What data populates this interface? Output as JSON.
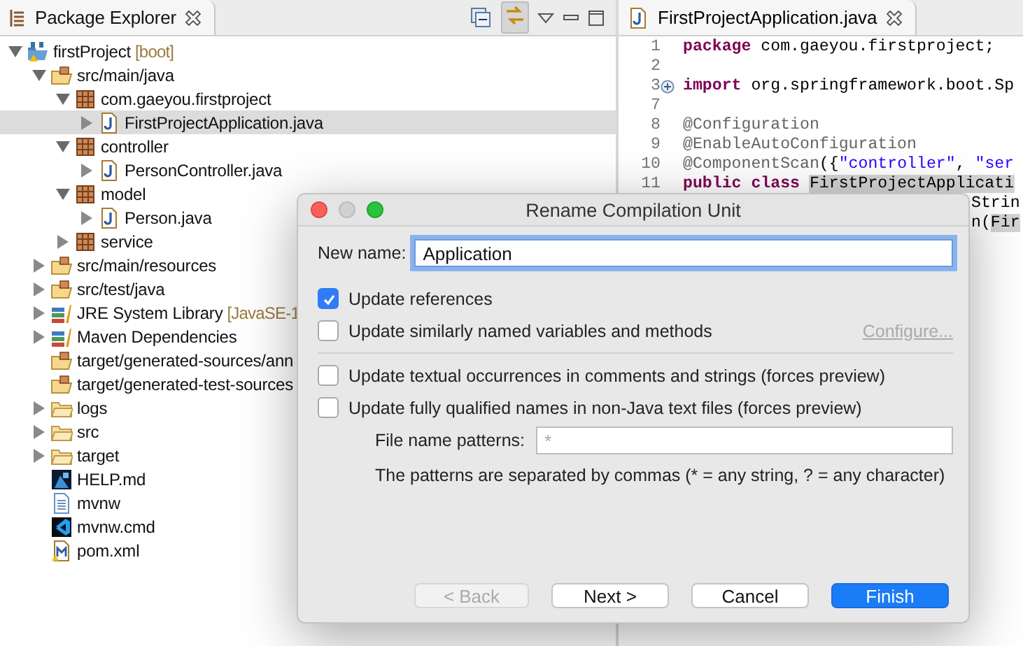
{
  "package_explorer": {
    "title": "Package Explorer",
    "tree": [
      {
        "label": "firstProject",
        "decoration": "[boot]",
        "kind": "project",
        "expanded": true,
        "selected": false,
        "children": [
          {
            "label": "src/main/java",
            "kind": "source-folder",
            "expanded": true,
            "selected": false,
            "children": [
              {
                "label": "com.gaeyou.firstproject",
                "kind": "package",
                "expanded": true,
                "selected": false,
                "children": [
                  {
                    "label": "FirstProjectApplication.java",
                    "kind": "java",
                    "expanded": false,
                    "selected": true
                  }
                ]
              },
              {
                "label": "controller",
                "kind": "package",
                "expanded": true,
                "selected": false,
                "children": [
                  {
                    "label": "PersonController.java",
                    "kind": "java",
                    "expanded": false,
                    "selected": false
                  }
                ]
              },
              {
                "label": "model",
                "kind": "package",
                "expanded": true,
                "selected": false,
                "children": [
                  {
                    "label": "Person.java",
                    "kind": "java",
                    "expanded": false,
                    "selected": false
                  }
                ]
              },
              {
                "label": "service",
                "kind": "package",
                "expanded": false,
                "selected": false
              }
            ]
          },
          {
            "label": "src/main/resources",
            "kind": "source-folder",
            "expanded": false,
            "selected": false
          },
          {
            "label": "src/test/java",
            "kind": "source-folder",
            "expanded": false,
            "selected": false
          },
          {
            "label": "JRE System Library",
            "decoration": "[JavaSE-1",
            "kind": "library",
            "expanded": false,
            "selected": false
          },
          {
            "label": "Maven Dependencies",
            "kind": "library",
            "expanded": false,
            "selected": false
          },
          {
            "label": "target/generated-sources/ann",
            "kind": "source-folder",
            "selected": false
          },
          {
            "label": "target/generated-test-sources",
            "kind": "source-folder",
            "selected": false
          },
          {
            "label": "logs",
            "kind": "folder",
            "expanded": false,
            "selected": false
          },
          {
            "label": "src",
            "kind": "folder",
            "expanded": false,
            "selected": false
          },
          {
            "label": "target",
            "kind": "folder",
            "expanded": false,
            "selected": false
          },
          {
            "label": "HELP.md",
            "kind": "image-file",
            "selected": false
          },
          {
            "label": "mvnw",
            "kind": "text-file",
            "selected": false
          },
          {
            "label": "mvnw.cmd",
            "kind": "cmd-file",
            "selected": false
          },
          {
            "label": "pom.xml",
            "kind": "xml-file",
            "selected": false
          }
        ]
      }
    ]
  },
  "editor": {
    "tab": "FirstProjectApplication.java",
    "lines": [
      {
        "kind": "line",
        "number": "1",
        "tokens": [
          {
            "kind": "kw",
            "t": "package"
          },
          {
            "kind": "plain",
            "t": " com.gaeyou.firstproject;"
          }
        ]
      },
      {
        "kind": "line",
        "number": "2"
      },
      {
        "kind": "line",
        "number": "3",
        "folded": true,
        "tokens": [
          {
            "kind": "kw",
            "t": "import"
          },
          {
            "kind": "plain",
            "t": " org.springframework.boot.Sp"
          }
        ]
      },
      {
        "kind": "line",
        "number": "7"
      },
      {
        "kind": "line",
        "number": "8",
        "tokens": [
          {
            "kind": "ann",
            "t": "@Configuration"
          }
        ]
      },
      {
        "kind": "line",
        "number": "9",
        "tokens": [
          {
            "kind": "ann",
            "t": "@EnableAutoConfiguration"
          }
        ]
      },
      {
        "kind": "line",
        "number": "10",
        "tokens": [
          {
            "kind": "ann",
            "t": "@ComponentScan"
          },
          {
            "kind": "plain",
            "t": "({"
          },
          {
            "kind": "str",
            "t": "\"controller\""
          },
          {
            "kind": "plain",
            "t": ", "
          },
          {
            "kind": "str",
            "t": "\"ser"
          }
        ]
      },
      {
        "kind": "line",
        "number": "11",
        "tokens": [
          {
            "kind": "kw",
            "t": "public class "
          },
          {
            "kind": "hl",
            "t": "FirstProjectApplicati"
          }
        ]
      },
      {
        "kind": "fragment",
        "tokens": [
          {
            "kind": "plain",
            "t": "Strin"
          }
        ]
      },
      {
        "kind": "fragment",
        "tokens": [
          {
            "kind": "plain",
            "t": "n("
          },
          {
            "kind": "hl",
            "t": "Fir"
          }
        ]
      }
    ]
  },
  "dialog": {
    "title": "Rename Compilation Unit",
    "new_name": {
      "label": "New name:",
      "value": "Application",
      "focused": true
    },
    "option_groups": [
      [
        {
          "label": "Update references",
          "checked": true
        },
        {
          "label": "Update similarly named variables and methods",
          "checked": false,
          "action": {
            "label": "Configure...",
            "disabled": true
          }
        }
      ],
      [
        {
          "label": "Update textual occurrences in comments and strings (forces preview)",
          "checked": false
        },
        {
          "label": "Update fully qualified names in non-Java text files (forces preview)",
          "checked": false
        }
      ]
    ],
    "patterns": {
      "label": "File name patterns:",
      "value": "*",
      "disabled": true
    },
    "note": "The patterns are separated by commas (* = any string, ? = any character)",
    "buttons": [
      {
        "label": "< Back",
        "disabled": true,
        "default": false
      },
      {
        "label": "Next >",
        "disabled": false,
        "default": false
      },
      {
        "label": "Cancel",
        "disabled": false,
        "default": false
      },
      {
        "label": "Finish",
        "disabled": false,
        "default": true
      }
    ]
  }
}
